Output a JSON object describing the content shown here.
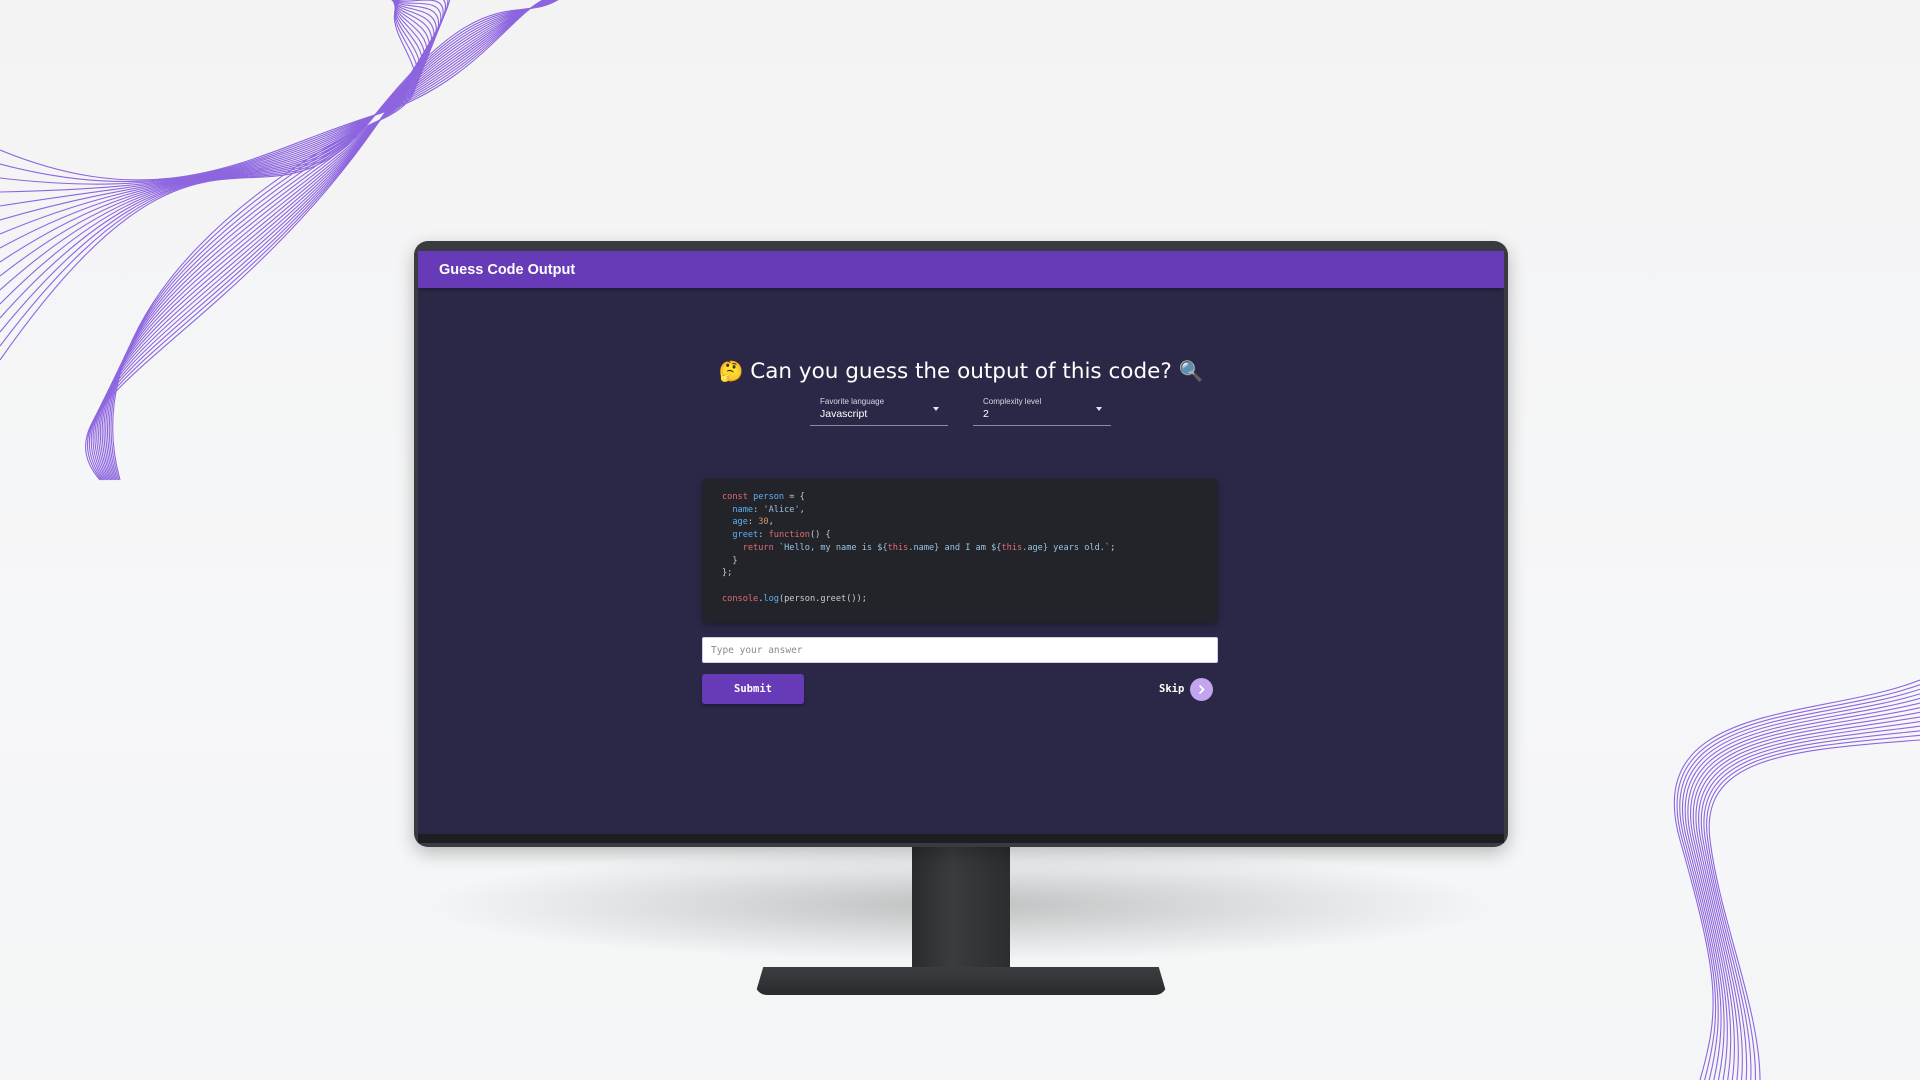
{
  "app": {
    "title": "Guess Code Output"
  },
  "heading": {
    "emoji_left": "🤔",
    "text": "Can you guess the output of this code?",
    "emoji_right": "🔍"
  },
  "selects": {
    "language": {
      "label": "Favorite language",
      "value": "Javascript"
    },
    "complexity": {
      "label": "Complexity level",
      "value": "2"
    }
  },
  "code": {
    "lines": [
      "const person = {",
      "  name: 'Alice',",
      "  age: 30,",
      "  greet: function() {",
      "    return `Hello, my name is ${this.name} and I am ${this.age} years old.`;",
      "  }",
      "};",
      "",
      "console.log(person.greet());"
    ]
  },
  "answer": {
    "placeholder": "Type your answer",
    "value": ""
  },
  "buttons": {
    "submit": "Submit",
    "skip": "Skip"
  },
  "colors": {
    "accent": "#673ab7",
    "screen_bg": "#2b2847",
    "code_bg": "#22242a",
    "wave": "#7c4ddb"
  },
  "icons": {
    "skip": "chevron-right-icon"
  }
}
